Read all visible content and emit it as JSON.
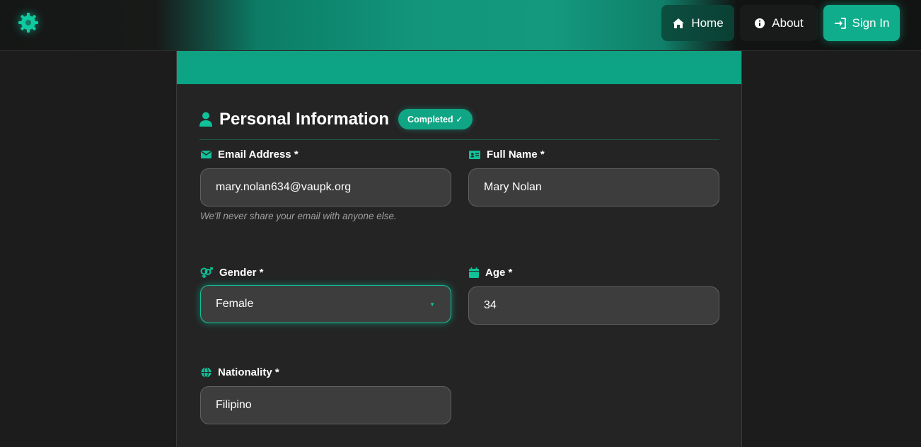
{
  "nav": {
    "home_label": "Home",
    "about_label": "About",
    "signin_label": "Sign In"
  },
  "section": {
    "title": "Personal Information",
    "badge": "Completed ✓"
  },
  "fields": {
    "email": {
      "label": "Email Address *",
      "value": "mary.nolan634@vaupk.org",
      "help": "We'll never share your email with anyone else."
    },
    "full_name": {
      "label": "Full Name *",
      "value": "Mary Nolan"
    },
    "gender": {
      "label": "Gender *",
      "value": "Female"
    },
    "age": {
      "label": "Age *",
      "value": "34"
    },
    "nationality": {
      "label": "Nationality *",
      "value": "Filipino"
    }
  },
  "colors": {
    "accent": "#10ad8c",
    "background": "#1b1c1b",
    "card": "#242424",
    "input": "#3d3d3d"
  },
  "icons": [
    "gear-icon",
    "home-icon",
    "info-icon",
    "sign-in-icon",
    "user-icon",
    "envelope-icon",
    "id-card-icon",
    "gender-icon",
    "calendar-icon",
    "globe-icon",
    "chevron-down-icon"
  ]
}
